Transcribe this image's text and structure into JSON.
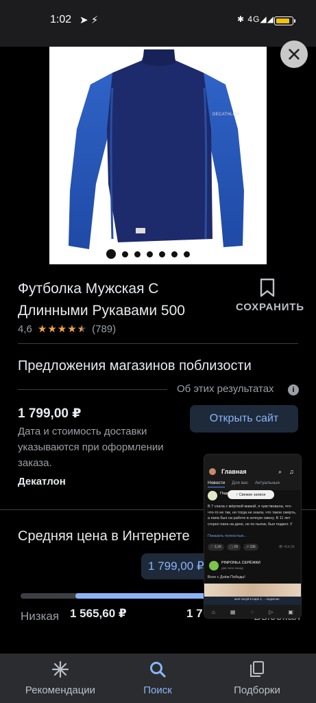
{
  "status_bar": {
    "time": "1:02",
    "left_icons": [
      "telegram-icon",
      "vpn-icon"
    ],
    "network": "4G",
    "battery_percent": 85
  },
  "product": {
    "image_label": "DECATHLON",
    "image_dots_total": 7,
    "image_dots_active_index": 0,
    "title": "Футболка Мужская С Длинными Рукавами 500",
    "save_label": "СОХРАНИТЬ",
    "rating_value": "4,6",
    "rating_stars": 4.6,
    "reviews_count": "(789)"
  },
  "offers": {
    "heading": "Предложения магазинов поблизости",
    "about_results": "Об этих результатах",
    "price": "1 799,00 ₽",
    "delivery_note": "Дата и стоимость доставки указываются при оформлении заказа.",
    "store": "Декатлон",
    "open_site_label": "Открыть сайт"
  },
  "average_price": {
    "heading": "Средняя цена в Интернете",
    "current": "1 799,00 ₽",
    "low_label": "Низкая",
    "low_price": "1 565,60 ₽",
    "high_price": "1 7",
    "high_label": "Высокая"
  },
  "mini_window": {
    "title": "Главная",
    "tabs": [
      "Новости",
      "Для вас",
      "Актуальные"
    ],
    "post_author": "Подс... Э...",
    "fresh_posts_pill": "↑ Свежие записи",
    "post_text": "В 7 спала с мёртвой мамой, я чувствовала, что-что-то не так, но тогда не знала, что такое смерть, а папа был на работе в ночную смену. В 11 лет сгорел папа на даче, не по пьяни, был поджог. У",
    "show_more": "Показать полностью...",
    "actions": [
      "♡ 3,1K",
      "▢ 29",
      "↗ 236"
    ],
    "views": "👁 414,2K",
    "post2_author": "PINPONЬ⅄ СЕРЁЖКИ",
    "post2_time": "два часа назад",
    "post2_text": "Всех с Днём Победы!",
    "player_text": "моё похуй в паре ⅄ ... подкачан",
    "nav": [
      "Главная",
      "Сервисы",
      "Мессенджер",
      "Клипы",
      "Видео"
    ]
  },
  "bottom_nav": {
    "items": [
      {
        "label": "Рекомендации",
        "icon": "asterisk-icon"
      },
      {
        "label": "Поиск",
        "icon": "search-icon"
      },
      {
        "label": "Подборки",
        "icon": "collections-icon"
      }
    ],
    "active_index": 1
  },
  "colors": {
    "accent": "#8ab4f8",
    "star": "#f4a442",
    "background": "#000000",
    "shirt_body": "#1d2a6b",
    "shirt_sleeve": "#2a58b8"
  }
}
